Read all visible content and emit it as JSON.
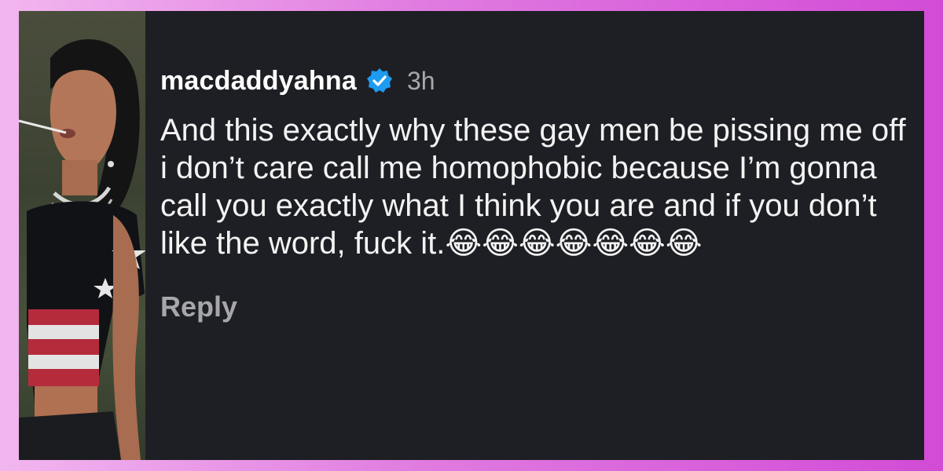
{
  "comment": {
    "username": "macdaddyahna",
    "timestamp": "3h",
    "verified_icon": "verified-badge-icon",
    "body": "And this exactly why these gay men be pissing me off i don’t care call me homophobic because I’m gonna call you exactly what I think you are and if you don’t like the word, fuck it.😂😂😂😂😂😂😂",
    "reply_label": "Reply"
  },
  "colors": {
    "background_left": "#f2b6ef",
    "background_right": "#d24bd6",
    "card": "#1e1f24",
    "verified": "#1d9bf0",
    "muted_text": "#a8a8ab"
  }
}
